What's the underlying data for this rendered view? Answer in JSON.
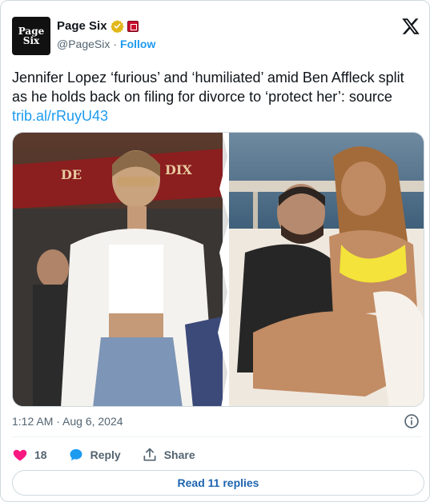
{
  "account": {
    "name": "Page Six",
    "handle": "@PageSix",
    "separator": "·",
    "follow_label": "Follow",
    "avatar_line1": "Page",
    "avatar_line2": "Six"
  },
  "tweet": {
    "text": "Jennifer Lopez ‘furious’ and ‘humiliated’ amid Ben Affleck split as he holds back on filing for divorce to ‘protect her’: source ",
    "link": "trib.al/rRuyU43",
    "timestamp": "1:12 AM · Aug 6, 2024"
  },
  "media": {
    "left_sign_text": "DE",
    "left_sign_text2": "DIX"
  },
  "actions": {
    "likes": "18",
    "reply_label": "Reply",
    "share_label": "Share"
  },
  "read_replies_label": "Read 11 replies",
  "colors": {
    "accent": "#1d9bf0",
    "like": "#f91880",
    "reply": "#1d9bf0",
    "text_secondary": "#536471",
    "read_link": "#1d65b0"
  },
  "icons": [
    "verified-badge-icon",
    "affiliate-badge-icon",
    "x-logo-icon",
    "info-icon",
    "heart-icon",
    "reply-bubble-icon",
    "share-icon"
  ]
}
